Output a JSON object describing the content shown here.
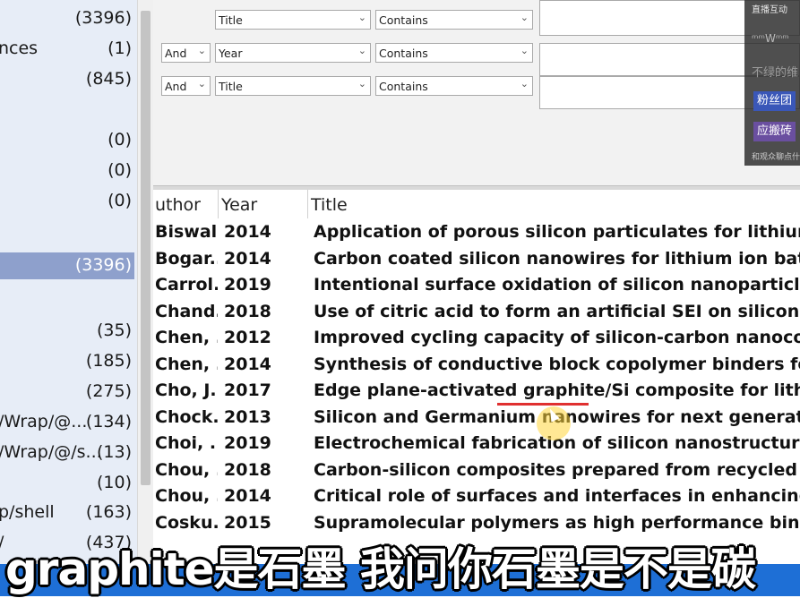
{
  "sidebar": {
    "groups": [
      {
        "name": "",
        "count": "(3396)",
        "selected": false
      },
      {
        "name": "nces",
        "count": "(1)",
        "selected": false
      },
      {
        "name": "",
        "count": "(845)",
        "selected": false
      },
      {
        "name": "",
        "count": "(0)",
        "selected": false
      },
      {
        "name": "",
        "count": "(0)",
        "selected": false
      },
      {
        "name": "",
        "count": "(0)",
        "selected": false
      },
      {
        "name": "",
        "count": "(3396)",
        "selected": true
      },
      {
        "name": "",
        "count": "(35)",
        "selected": false
      },
      {
        "name": "",
        "count": "(185)",
        "selected": false
      },
      {
        "name": "",
        "count": "(275)",
        "selected": false
      },
      {
        "name": "/Wrap/@...",
        "count": "(134)",
        "selected": false
      },
      {
        "name": "/Wrap/@/s...",
        "count": "(13)",
        "selected": false
      },
      {
        "name": "",
        "count": "(10)",
        "selected": false
      },
      {
        "name": "p/shell",
        "count": "(163)",
        "selected": false
      },
      {
        "name": "/",
        "count": "(437)",
        "selected": false
      }
    ]
  },
  "search": {
    "rows": [
      {
        "logic": "",
        "field": "Title",
        "op": "Contains"
      },
      {
        "logic": "And",
        "field": "Year",
        "op": "Contains"
      },
      {
        "logic": "And",
        "field": "Title",
        "op": "Contains"
      }
    ]
  },
  "table": {
    "headers": {
      "author": "uthor",
      "year": "Year",
      "title": "Title"
    },
    "rows": [
      {
        "author": "Biswal...",
        "year": "2014",
        "title": "Application of porous silicon particulates for lithium ion"
      },
      {
        "author": "Bogar...",
        "year": "2014",
        "title": "Carbon coated silicon nanowires for lithium ion battery e"
      },
      {
        "author": "Carrol...",
        "year": "2019",
        "title": "Intentional surface oxidation of silicon nanoparticles for"
      },
      {
        "author": "Chand...",
        "year": "2018",
        "title": "Use of citric acid to form an artificial SEI on silicon nanop"
      },
      {
        "author": "Chen, ...",
        "year": "2012",
        "title": "Improved cycling capacity of silicon-carbon nanocompos"
      },
      {
        "author": "Chen, ...",
        "year": "2014",
        "title": "Synthesis of conductive block copolymer binders for the"
      },
      {
        "author": "Cho, J...",
        "year": "2017",
        "title": "Edge plane-activated graphite/Si composite for lithium io"
      },
      {
        "author": "Chock...",
        "year": "2013",
        "title": "Silicon and Germanium nanowires for next generation hig"
      },
      {
        "author": "Choi, ...",
        "year": "2019",
        "title": "Electrochemical fabrication of silicon nanostructure for a"
      },
      {
        "author": "Chou, ...",
        "year": "2018",
        "title": "Carbon-silicon composites prepared from recycled kerf-le"
      },
      {
        "author": "Chou, ...",
        "year": "2014",
        "title": "Critical role of surfaces and interfaces in enhancing the p"
      },
      {
        "author": "Cosku...",
        "year": "2015",
        "title": "Supramolecular polymers as high performance binders fo"
      }
    ]
  },
  "overlay": {
    "title": "直播互动",
    "line1": "ᵐᵐWᵐᵐ",
    "line2": "不绿的维",
    "badge1": "粉丝团",
    "badge2": "应搬砖",
    "footer": "和观众聊点什"
  },
  "subtitle": {
    "text": "graphite是石墨 我问你石墨是不是碳"
  },
  "colors": {
    "sidebar_bg": "#e7edf7",
    "selected_bg": "#8ea0cc",
    "subtitle_band": "#1e6fd6",
    "underline": "#e03030"
  }
}
